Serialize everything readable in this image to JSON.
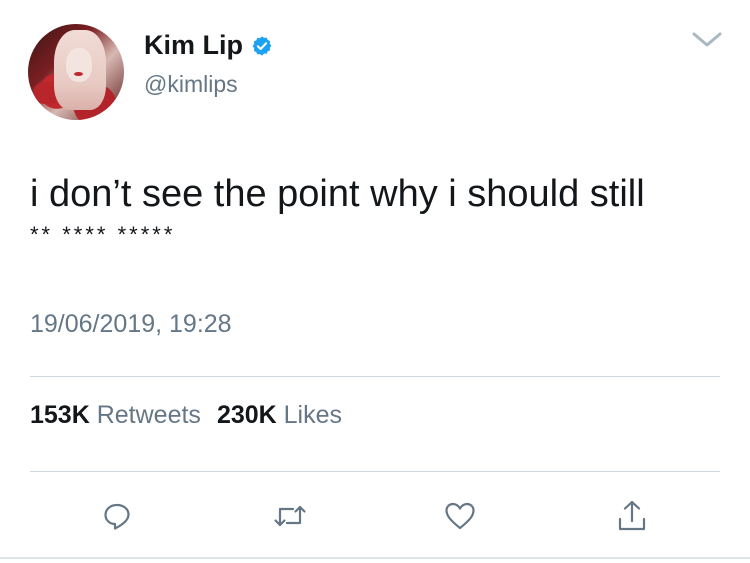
{
  "user": {
    "display_name": "Kim Lip",
    "handle": "@kimlips",
    "verified": true
  },
  "tweet": {
    "text": "i don’t see the point why i should still",
    "censored_line": "** **** *****",
    "timestamp": "19/06/2019, 19:28"
  },
  "stats": {
    "retweets_count": "153K",
    "retweets_label": "Retweets",
    "likes_count": "230K",
    "likes_label": "Likes"
  },
  "actions": [
    "reply-icon",
    "retweet-icon",
    "like-icon",
    "share-icon"
  ],
  "colors": {
    "text_primary": "#14171a",
    "text_secondary": "#657786",
    "divider": "#ccd6dd",
    "verified_blue": "#1da1f2",
    "icon_gray": "#657786"
  }
}
